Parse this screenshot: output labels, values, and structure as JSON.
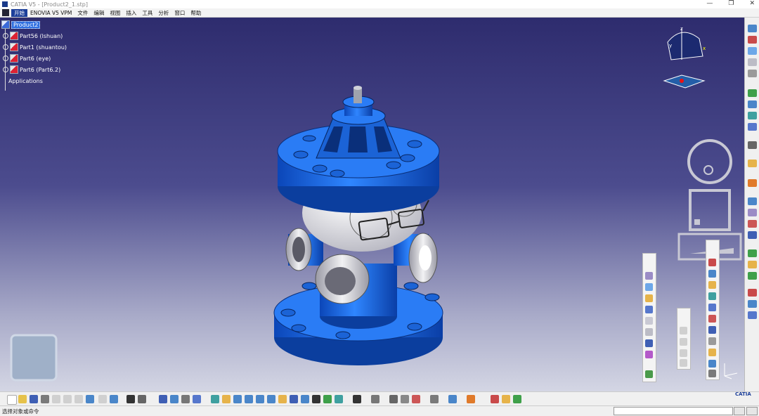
{
  "window": {
    "title": "CATIA V5 - [Product2_1.stp]",
    "controls": [
      "—",
      "❐",
      "✕"
    ]
  },
  "menu": [
    {
      "label": "开始",
      "active": true
    },
    {
      "label": "ENOVIA V5 VPM"
    },
    {
      "label": "文件"
    },
    {
      "label": "编辑"
    },
    {
      "label": "视图"
    },
    {
      "label": "插入"
    },
    {
      "label": "工具"
    },
    {
      "label": "分析"
    },
    {
      "label": "窗口"
    },
    {
      "label": "帮助"
    }
  ],
  "tree": {
    "root": "Product2",
    "children": [
      "Part56 (lshuan)",
      "Part1 (shuantou)",
      "Part6 (eye)",
      "Part6 (Part6.2)"
    ],
    "applications": "Applications"
  },
  "compass": {
    "x_label": "x",
    "y_label": "y",
    "z_label": "z"
  },
  "colors": {
    "model_blue": "#1e6fe0",
    "background_top": "#2e2c6e",
    "accent": "#1c3f9a"
  },
  "statusbar": {
    "message": "选择对象或命令"
  },
  "brand": {
    "logo_text": "CATIA"
  },
  "icons": {
    "right_toolbar": [
      "view-icon",
      "fly-icon",
      "rotate-icon",
      "zoom-icon",
      "fit-icon",
      "normal-view-icon",
      "multi-view-icon",
      "render-icon",
      "hide-icon",
      "swap-icon",
      "select-icon",
      "constraint-icon",
      "catalog-icon",
      "measure-icon",
      "snap-icon",
      "move-icon",
      "scene-icon",
      "analyze-icon",
      "publish-icon",
      "product-icon",
      "assembly-icon"
    ],
    "bottom_toolbar": [
      "new-icon",
      "open-icon",
      "save-icon",
      "print-icon",
      "cut-icon",
      "copy-icon",
      "paste-icon",
      "undo-icon",
      "redo-icon",
      "help-icon",
      "formula-icon",
      "comment-icon",
      "table-icon",
      "tree-icon",
      "catalog-icon",
      "fly-mode-icon",
      "fit-all-icon",
      "pan-icon",
      "rotate-icon",
      "zoom-in-icon",
      "zoom-out-icon",
      "normal-view-icon",
      "iso-view-icon",
      "view-mode-icon",
      "hide-show-icon",
      "swap-space-icon",
      "camera-icon",
      "sketch-icon",
      "measure-icon",
      "analysis-icon",
      "link-icon",
      "material-icon",
      "grid-icon",
      "render-icon",
      "apply-material-icon"
    ]
  }
}
